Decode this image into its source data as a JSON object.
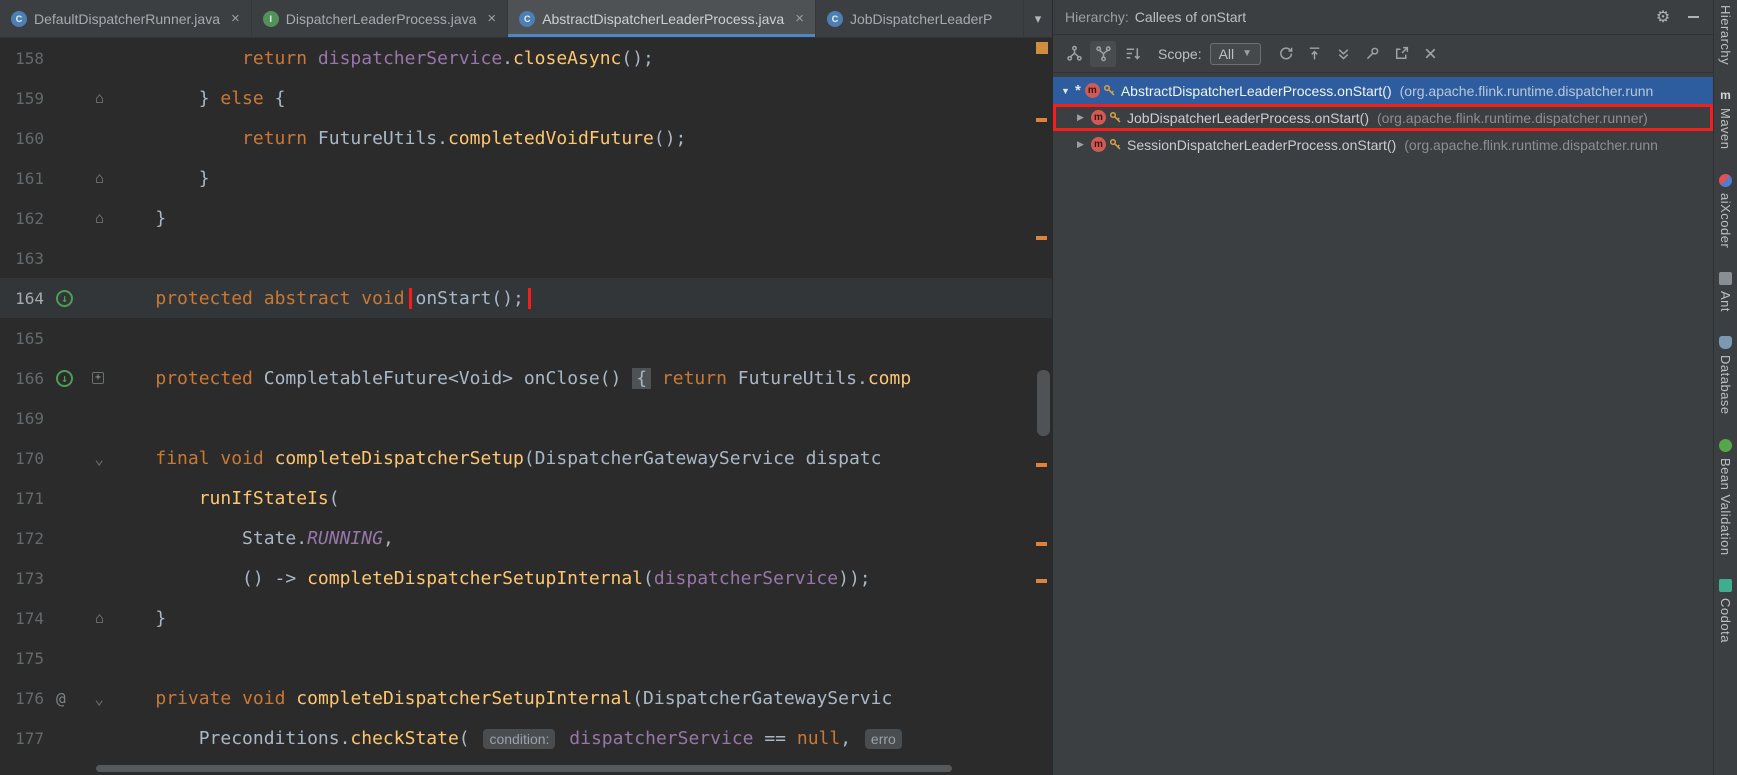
{
  "colors": {
    "annotation_red": "#f71d1d",
    "selection_blue": "#2d5d9e",
    "keyword_orange": "#cc7832",
    "method_yellow": "#ffc66d",
    "field_purple": "#9876aa",
    "change_marker_orange": "#e0813c",
    "active_tab_underline": "#4a88c7"
  },
  "tabs": {
    "items": [
      {
        "label": "DefaultDispatcherRunner.java",
        "kind": "class",
        "letter": "C",
        "closable": true,
        "active": false,
        "truncated": false
      },
      {
        "label": "DispatcherLeaderProcess.java",
        "kind": "interface",
        "letter": "I",
        "closable": true,
        "active": false,
        "truncated": false
      },
      {
        "label": "AbstractDispatcherLeaderProcess.java",
        "kind": "class",
        "letter": "C",
        "closable": true,
        "active": true,
        "truncated": false
      },
      {
        "label": "JobDispatcherLeaderP",
        "kind": "class",
        "letter": "C",
        "closable": false,
        "active": false,
        "truncated": true
      }
    ],
    "overflow_chevron": "▾"
  },
  "editor": {
    "lines": [
      {
        "num": "158",
        "gutter": [],
        "tokens": [
          [
            "pln",
            "            "
          ],
          [
            "kw",
            "return"
          ],
          [
            "pln",
            " "
          ],
          [
            "fld",
            "dispatcherService"
          ],
          [
            "pln",
            "."
          ],
          [
            "mth",
            "closeAsync"
          ],
          [
            "pln",
            "();"
          ]
        ]
      },
      {
        "num": "159",
        "gutter": [
          "foldend"
        ],
        "tokens": [
          [
            "pln",
            "        } "
          ],
          [
            "kw",
            "else"
          ],
          [
            "pln",
            " {"
          ]
        ]
      },
      {
        "num": "160",
        "gutter": [],
        "tokens": [
          [
            "pln",
            "            "
          ],
          [
            "kw",
            "return"
          ],
          [
            "pln",
            " FutureUtils."
          ],
          [
            "mth",
            "completedVoidFuture"
          ],
          [
            "pln",
            "();"
          ]
        ]
      },
      {
        "num": "161",
        "gutter": [
          "foldend"
        ],
        "tokens": [
          [
            "pln",
            "        }"
          ]
        ]
      },
      {
        "num": "162",
        "gutter": [
          "foldend"
        ],
        "tokens": [
          [
            "pln",
            "    }"
          ]
        ]
      },
      {
        "num": "163",
        "gutter": [],
        "tokens": []
      },
      {
        "num": "164",
        "current": true,
        "gutter": [
          "impl"
        ],
        "tokens": [
          [
            "pln",
            "    "
          ],
          [
            "kw",
            "protected"
          ],
          [
            "pln",
            " "
          ],
          [
            "kw",
            "abstract"
          ],
          [
            "pln",
            " "
          ],
          [
            "kw",
            "void"
          ],
          [
            "pln",
            " "
          ],
          [
            "boxed",
            "onStart();"
          ]
        ]
      },
      {
        "num": "165",
        "gutter": [],
        "tokens": []
      },
      {
        "num": "166",
        "gutter": [
          "impl",
          "foldplus"
        ],
        "tokens": [
          [
            "pln",
            "    "
          ],
          [
            "kw",
            "protected"
          ],
          [
            "pln",
            " CompletableFuture<Void> "
          ],
          [
            "pln",
            "onClose"
          ],
          [
            "pln",
            "() "
          ],
          [
            "fold",
            "{"
          ],
          [
            "pln",
            " "
          ],
          [
            "kw",
            "return"
          ],
          [
            "pln",
            " FutureUtils."
          ],
          [
            "mth",
            "comp"
          ]
        ]
      },
      {
        "num": "169",
        "gutter": [],
        "tokens": []
      },
      {
        "num": "170",
        "gutter": [
          "folddown"
        ],
        "tokens": [
          [
            "pln",
            "    "
          ],
          [
            "kw",
            "final"
          ],
          [
            "pln",
            " "
          ],
          [
            "kw",
            "void"
          ],
          [
            "pln",
            " "
          ],
          [
            "mth",
            "completeDispatcherSetup"
          ],
          [
            "pln",
            "(DispatcherGatewayService dispatc"
          ]
        ]
      },
      {
        "num": "171",
        "gutter": [],
        "tokens": [
          [
            "pln",
            "        "
          ],
          [
            "mth",
            "runIfStateIs"
          ],
          [
            "pln",
            "("
          ]
        ]
      },
      {
        "num": "172",
        "gutter": [],
        "tokens": [
          [
            "pln",
            "            State."
          ],
          [
            "cst",
            "RUNNING"
          ],
          [
            "pln",
            ","
          ]
        ]
      },
      {
        "num": "173",
        "gutter": [],
        "tokens": [
          [
            "pln",
            "            () -> "
          ],
          [
            "mth",
            "completeDispatcherSetupInternal"
          ],
          [
            "pln",
            "("
          ],
          [
            "fld",
            "dispatcherService"
          ],
          [
            "pln",
            "));"
          ]
        ]
      },
      {
        "num": "174",
        "gutter": [
          "foldend"
        ],
        "tokens": [
          [
            "pln",
            "    }"
          ]
        ]
      },
      {
        "num": "175",
        "gutter": [],
        "tokens": []
      },
      {
        "num": "176",
        "gutter": [
          "at",
          "folddown"
        ],
        "tokens": [
          [
            "pln",
            "    "
          ],
          [
            "kw",
            "private"
          ],
          [
            "pln",
            " "
          ],
          [
            "kw",
            "void"
          ],
          [
            "pln",
            " "
          ],
          [
            "mth",
            "completeDispatcherSetupInternal"
          ],
          [
            "pln",
            "(DispatcherGatewayServic"
          ]
        ]
      },
      {
        "num": "177",
        "gutter": [],
        "tokens": [
          [
            "pln",
            "        Preconditions."
          ],
          [
            "mth",
            "checkState"
          ],
          [
            "pln",
            "( "
          ],
          [
            "hint",
            "condition:"
          ],
          [
            "pln",
            " "
          ],
          [
            "fld",
            "dispatcherService"
          ],
          [
            "pln",
            " == "
          ],
          [
            "kw",
            "null"
          ],
          [
            "pln",
            ", "
          ],
          [
            "hint",
            "erro"
          ]
        ]
      }
    ]
  },
  "hierarchy": {
    "title_label": "Hierarchy:",
    "title_value": "Callees of onStart",
    "scope_label": "Scope:",
    "scope_value": "All",
    "rows": [
      {
        "caret": "down",
        "selected": true,
        "annotated": false,
        "base_marker": "*",
        "main": "AbstractDispatcherLeaderProcess.onStart()",
        "pkg": "(org.apache.flink.runtime.dispatcher.runn"
      },
      {
        "caret": "right",
        "selected": false,
        "annotated": true,
        "main": "JobDispatcherLeaderProcess.onStart()",
        "pkg": "(org.apache.flink.runtime.dispatcher.runner)"
      },
      {
        "caret": "right",
        "selected": false,
        "annotated": false,
        "main": "SessionDispatcherLeaderProcess.onStart()",
        "pkg": "(org.apache.flink.runtime.dispatcher.runn"
      }
    ]
  },
  "right_strip": {
    "items": [
      {
        "label": "Hierarchy",
        "icon": null
      },
      {
        "label": "Maven",
        "icon": "maven-icon"
      },
      {
        "label": "aiXcoder",
        "icon": "aixcoder-icon"
      },
      {
        "label": "Ant",
        "icon": "ant-icon"
      },
      {
        "label": "Database",
        "icon": "database-icon"
      },
      {
        "label": "Bean Validation",
        "icon": "bean-validation-icon"
      },
      {
        "label": "Codota",
        "icon": "codota-icon"
      }
    ]
  }
}
